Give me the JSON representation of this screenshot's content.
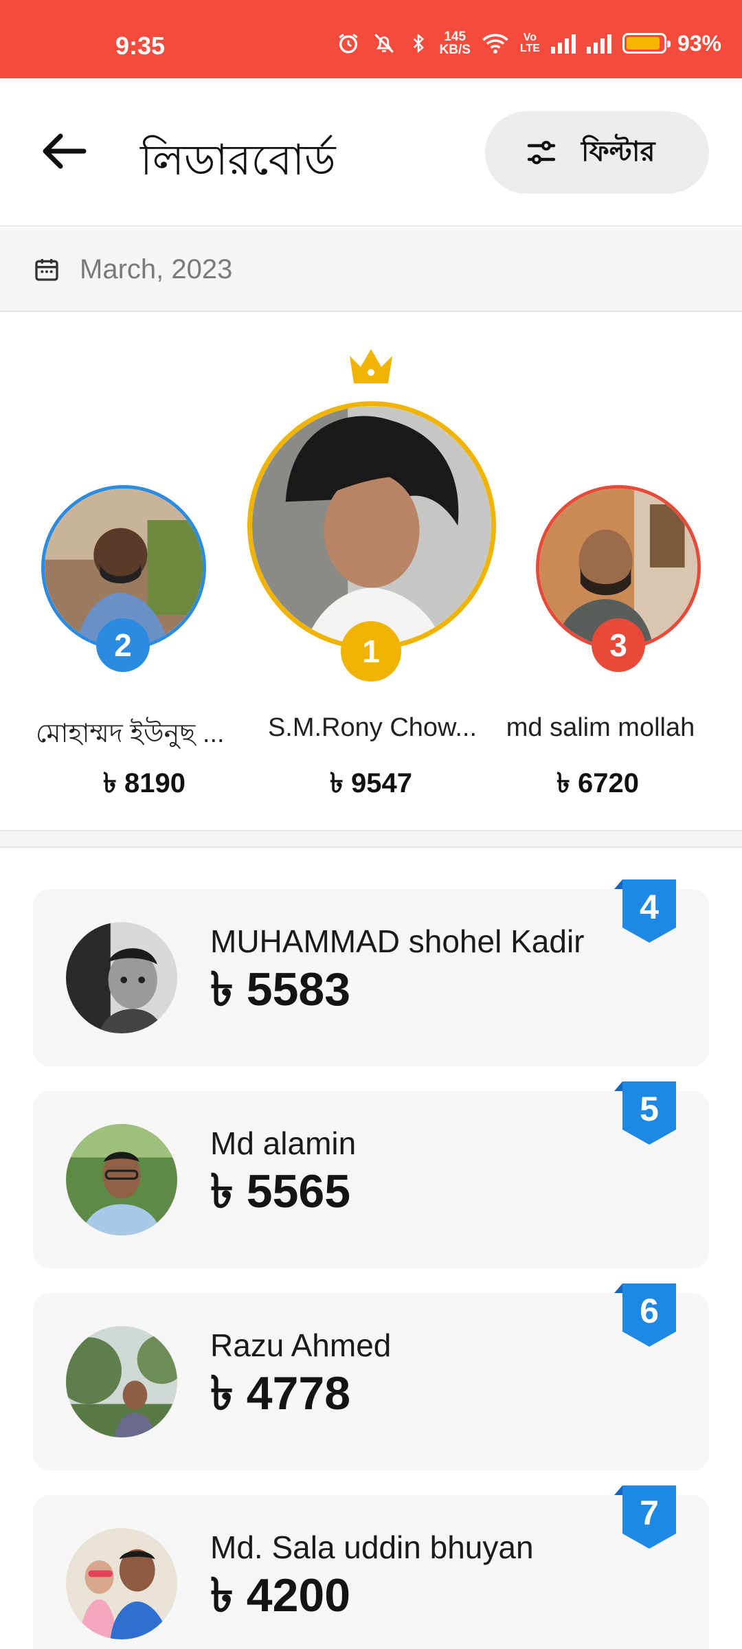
{
  "status_bar": {
    "time": "9:35",
    "speed_value": "145",
    "speed_unit": "KB/S",
    "volte_top": "Vo",
    "volte_bottom": "LTE",
    "battery_pct": "93%",
    "icons": [
      "alarm-icon",
      "mute-icon",
      "bluetooth-icon",
      "wifi-icon",
      "signal-icon",
      "signal-icon",
      "battery-icon"
    ],
    "battery_level": 0.93
  },
  "header": {
    "title": "লিডারবোর্ড",
    "filter_label": "ফিল্টার"
  },
  "date_row": {
    "date": "March, 2023"
  },
  "colors": {
    "status_bar": "#f44b3c",
    "gold": "#f0b400",
    "blue": "#2a8be0",
    "red": "#e84a3a",
    "ribbon": "#1e88e5"
  },
  "podium": {
    "first": {
      "rank": "1",
      "name": "S.M.Rony Chow...",
      "score": "৳ 9547"
    },
    "second": {
      "rank": "2",
      "name": "মোহাম্মদ ইউনুছ ...",
      "score": "৳ 8190"
    },
    "third": {
      "rank": "3",
      "name": "md salim mollah",
      "score": "৳ 6720"
    }
  },
  "list": [
    {
      "rank": "4",
      "name": "MUHAMMAD shohel Kadir",
      "score": "৳ 5583"
    },
    {
      "rank": "5",
      "name": "Md alamin",
      "score": "৳ 5565"
    },
    {
      "rank": "6",
      "name": "Razu Ahmed",
      "score": "৳ 4778"
    },
    {
      "rank": "7",
      "name": "Md. Sala uddin bhuyan",
      "score": "৳ 4200"
    }
  ]
}
